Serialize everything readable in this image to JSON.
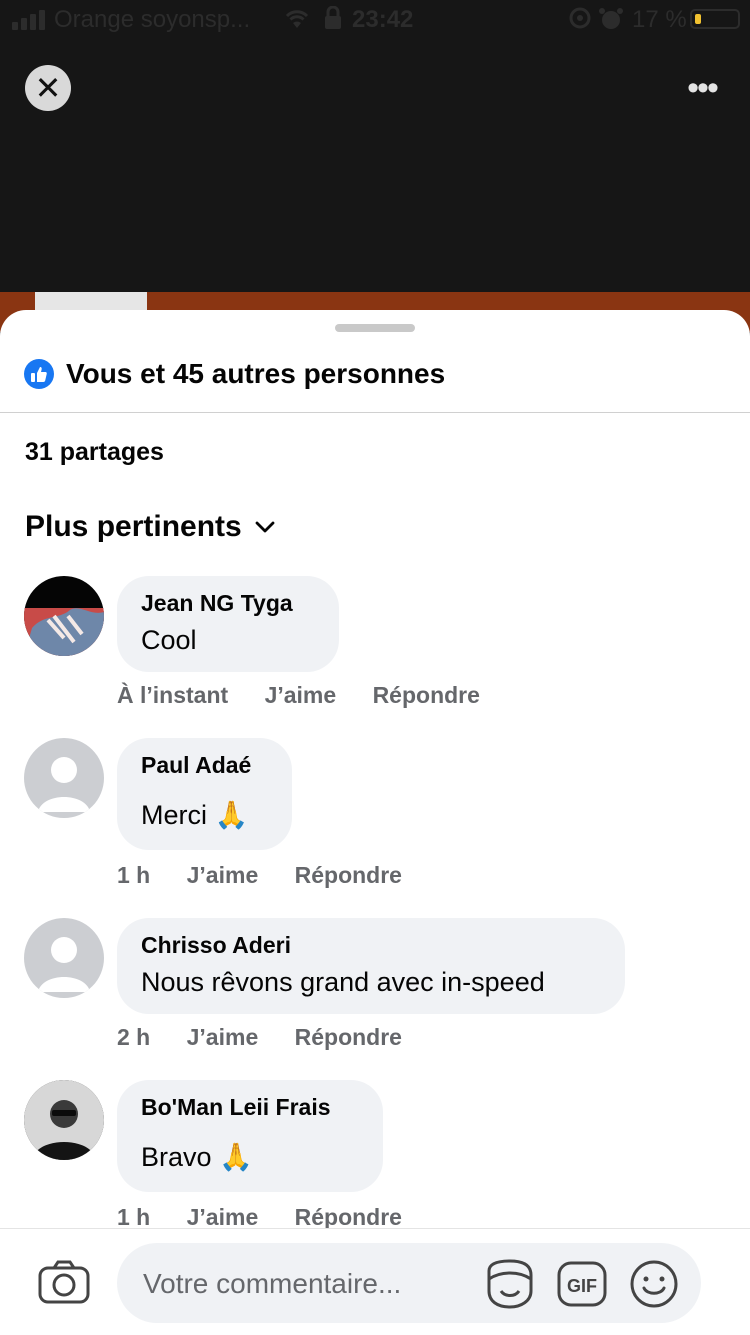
{
  "status_bar": {
    "carrier": "Orange soyonsp...",
    "time": "23:42",
    "battery_percent": "17 %",
    "battery_level": 0.17
  },
  "sheet": {
    "likes_text": "Vous et 45 autres personnes",
    "shares_text": "31 partages",
    "sort_label": "Plus pertinents"
  },
  "comments": [
    {
      "author": "Jean NG Tyga",
      "text": "Cool",
      "time": "À l’instant",
      "like": "J’aime",
      "reply": "Répondre"
    },
    {
      "author": "Paul Adaé",
      "text": "Merci 🙏",
      "time": "1 h",
      "like": "J’aime",
      "reply": "Répondre"
    },
    {
      "author": "Chrisso Aderi",
      "text": "Nous rêvons grand avec in-speed",
      "time": "2 h",
      "like": "J’aime",
      "reply": "Répondre"
    },
    {
      "author": "Bo'Man Leii Frais",
      "text": "Bravo 🙏",
      "time": "1 h",
      "like": "J’aime",
      "reply": "Répondre"
    }
  ],
  "composer": {
    "placeholder": "Votre commentaire...",
    "gif_label": "GIF"
  },
  "colors": {
    "accent": "#1877f2",
    "bubble": "#f0f2f5",
    "secondary_text": "#65676b"
  }
}
